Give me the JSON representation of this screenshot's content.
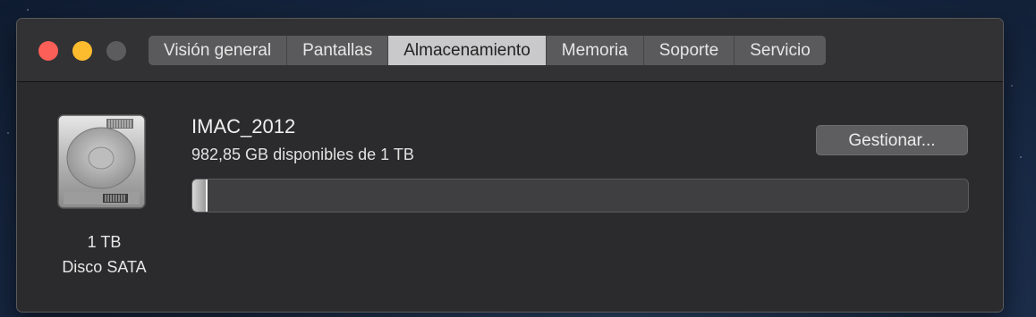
{
  "window": {
    "tabs": [
      {
        "label": "Visión general",
        "active": false
      },
      {
        "label": "Pantallas",
        "active": false
      },
      {
        "label": "Almacenamiento",
        "active": true
      },
      {
        "label": "Memoria",
        "active": false
      },
      {
        "label": "Soporte",
        "active": false
      },
      {
        "label": "Servicio",
        "active": false
      }
    ]
  },
  "storage": {
    "disk_icon": "hard-drive-icon",
    "disk_size": "1 TB",
    "disk_type": "Disco SATA",
    "volume_name": "IMAC_2012",
    "free_text": "982,85 GB disponibles de 1 TB",
    "manage_label": "Gestionar...",
    "used_fraction": 0.017
  },
  "colors": {
    "close": "#fc5f57",
    "minimize": "#fdbc2e",
    "zoom_disabled": "#5c5c5e",
    "active_tab": "#c9c9cb"
  }
}
